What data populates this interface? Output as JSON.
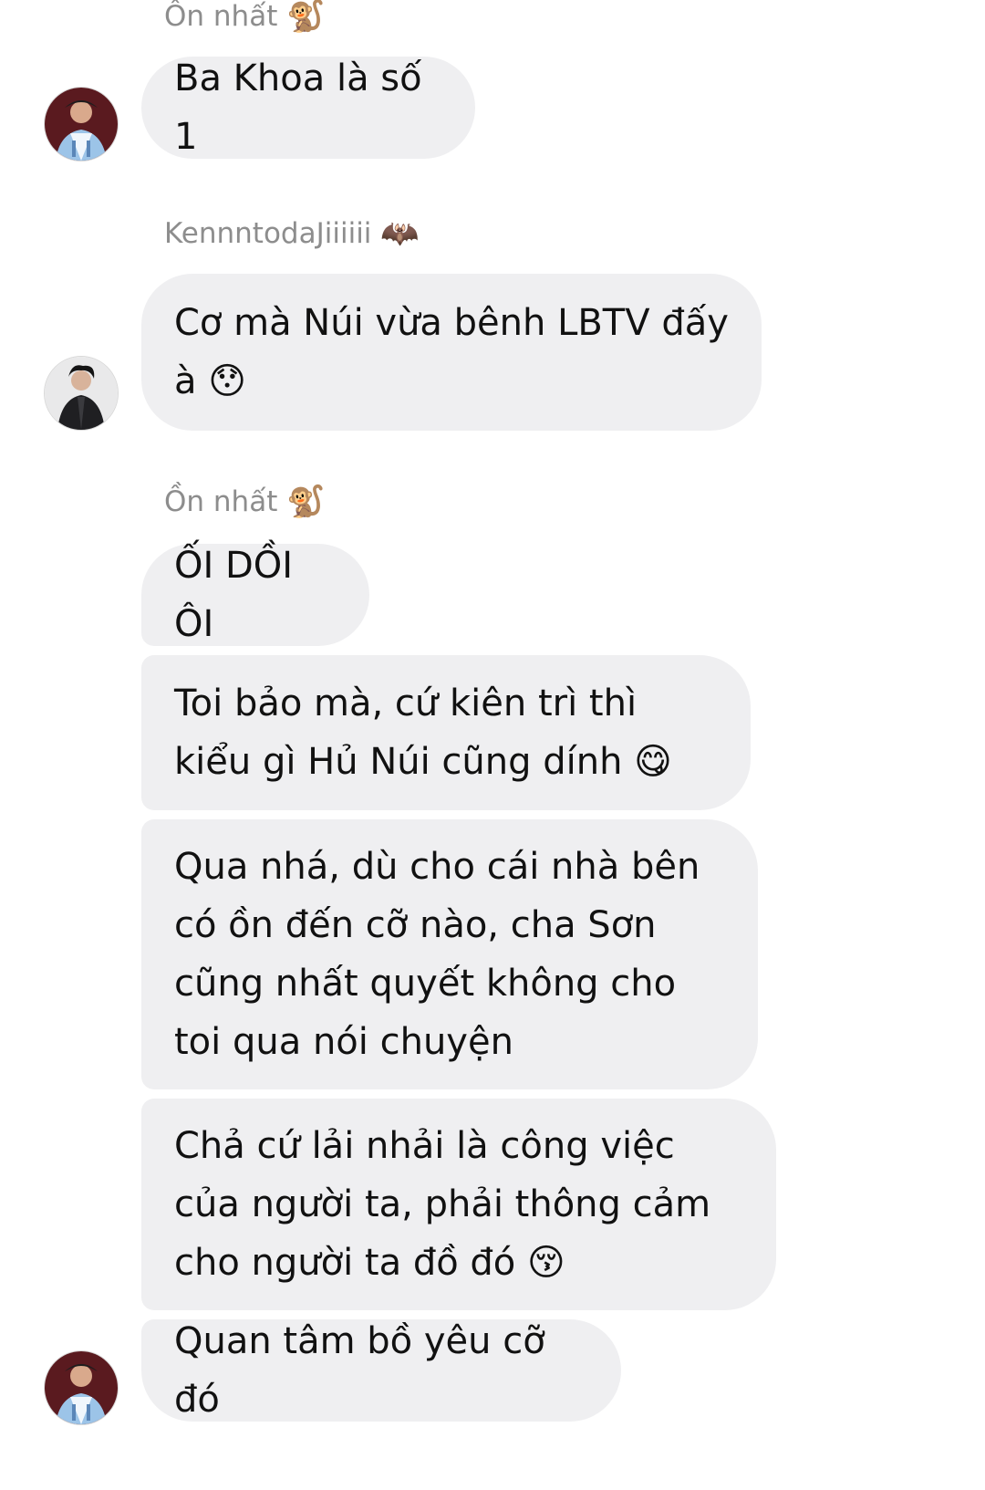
{
  "messages": [
    {
      "sender": "Ồn nhất",
      "sender_emoji": "🐒",
      "text": "Ba Khoa là số 1"
    },
    {
      "sender": "KennntodaJiiiiii",
      "sender_emoji": "🦇",
      "text": "Cơ mà Núi vừa bênh LBTV đấy à 😯"
    },
    {
      "sender": "Ồn nhất",
      "sender_emoji": "🐒",
      "texts": [
        "ỐI DỒI ÔI",
        "Toi bảo mà, cứ kiên trì thì kiểu gì Hủ Núi cũng dính 😋",
        "Qua nhá, dù cho cái nhà bên có ồn đến cỡ nào, cha Sơn cũng nhất quyết không cho toi qua nói chuyện",
        "Chả cứ lải nhải là công việc của người ta, phải thông cảm cho người ta đồ đó 😚",
        "Quan tâm bồ yêu cỡ đó"
      ]
    }
  ],
  "icons": {
    "avatar_a": "avatar-red-jacket-icon",
    "avatar_b": "avatar-dark-jacket-icon"
  },
  "colors": {
    "bubble": "#efeff1",
    "sender_name": "#8d8d8d",
    "text": "#111111"
  }
}
